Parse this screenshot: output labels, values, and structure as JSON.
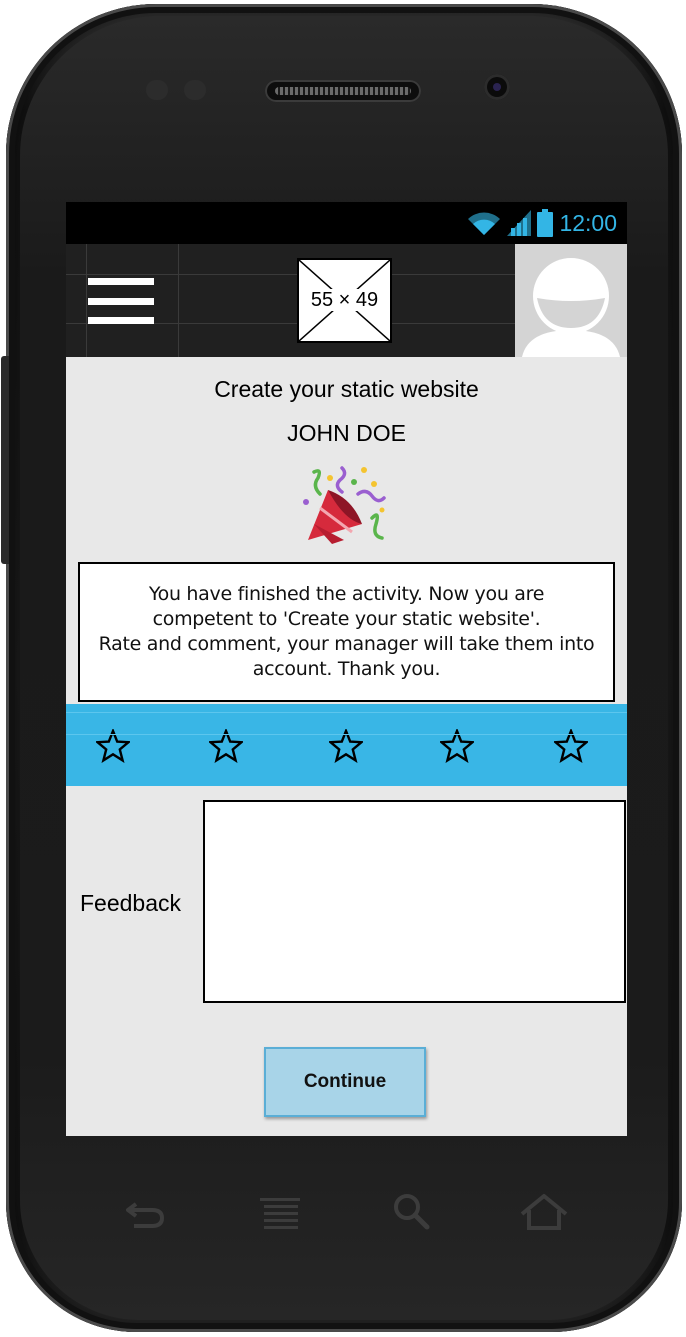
{
  "status_bar": {
    "time": "12:00",
    "icons": [
      "wifi-icon",
      "signal-icon",
      "battery-icon"
    ],
    "accent_color": "#33b5e5"
  },
  "app_bar": {
    "menu_icon": "hamburger-menu-icon",
    "logo_placeholder": "55 × 49",
    "avatar_icon": "user-avatar-icon"
  },
  "content": {
    "title": "Create your static website",
    "user_name": "JOHN DOE",
    "celebration_icon": "party-popper-icon",
    "message_lines": [
      "You have finished the activity. Now you are",
      "competent to 'Create your static website'.",
      "Rate and comment, your manager will take them into",
      "account. Thank you."
    ]
  },
  "rating": {
    "max_stars": 5,
    "selected": 0,
    "bar_color": "#39b6e6",
    "star_icon": "star-outline-icon"
  },
  "feedback": {
    "label": "Feedback",
    "value": ""
  },
  "actions": {
    "continue_label": "Continue"
  },
  "hardware_nav": [
    "back-icon",
    "menu-icon",
    "search-icon",
    "home-icon"
  ]
}
